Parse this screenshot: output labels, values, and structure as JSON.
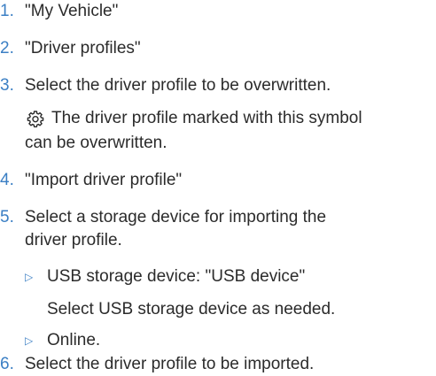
{
  "steps": [
    {
      "num": "1.",
      "text": "\"My Vehicle\""
    },
    {
      "num": "2.",
      "text": "\"Driver profiles\""
    },
    {
      "num": "3.",
      "text": "Select the driver profile to be overwritten."
    },
    {
      "num": "4.",
      "text": "\"Import driver profile\""
    },
    {
      "num": "5.",
      "text_line1": "Select a storage device for importing the",
      "text_line2": "driver profile."
    },
    {
      "num": "6.",
      "text": "Select the driver profile to be imported."
    }
  ],
  "note": {
    "icon": "gear-icon",
    "line1": "The driver profile marked with this symbol",
    "line2": "can be overwritten."
  },
  "substeps": [
    {
      "marker": "▷",
      "text": "USB storage device: \"USB device\"",
      "detail": "Select USB storage device as needed."
    },
    {
      "marker": "▷",
      "text": "Online."
    }
  ],
  "colors": {
    "accent": "#3b7fc4",
    "text": "#2b2b2b"
  }
}
